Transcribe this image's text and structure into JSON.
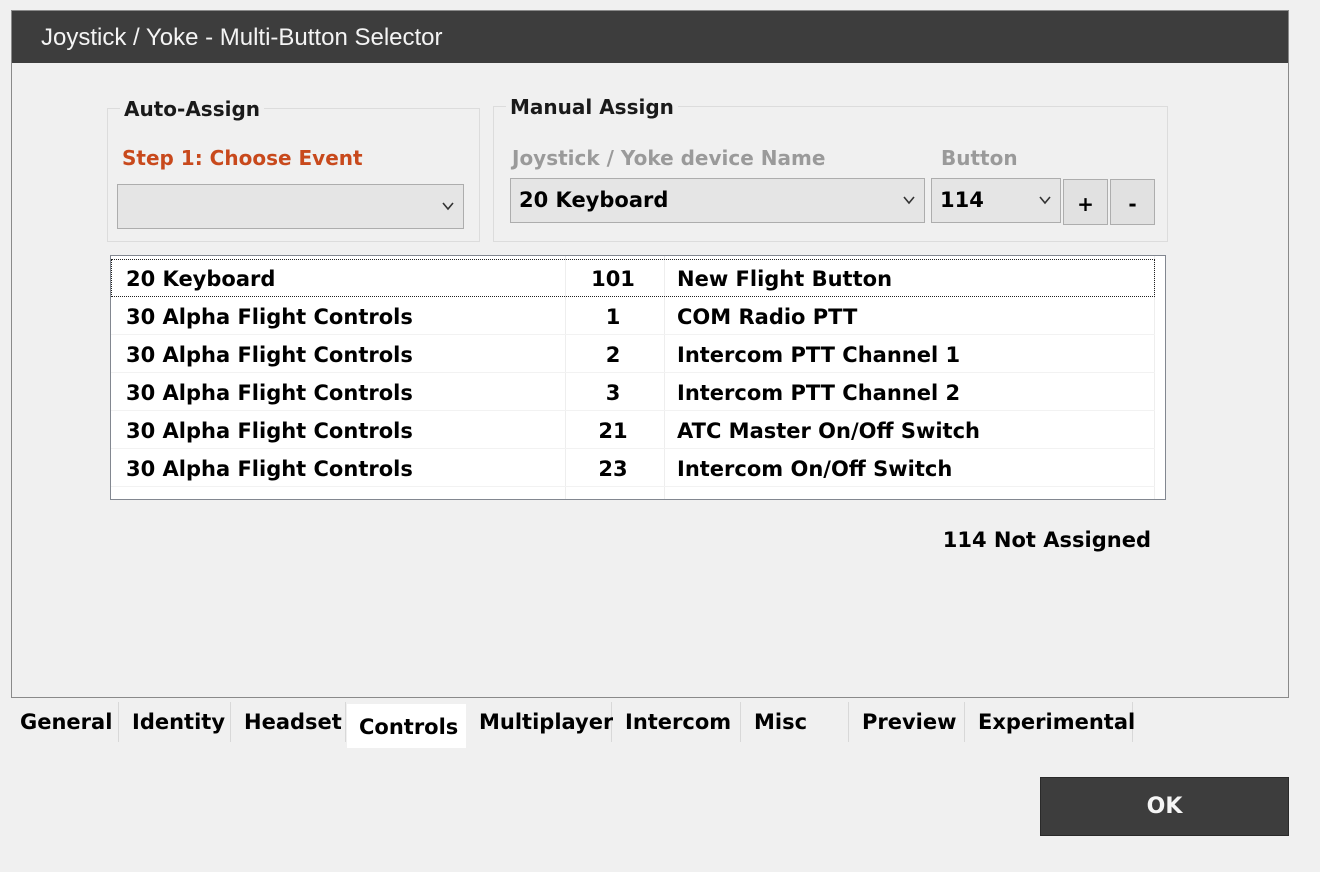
{
  "window": {
    "title": "Joystick / Yoke - Multi-Button Selector"
  },
  "auto_assign": {
    "legend": "Auto-Assign",
    "step_label": "Step 1: Choose Event",
    "event_value": ""
  },
  "manual_assign": {
    "legend": "Manual Assign",
    "device_label": "Joystick / Yoke device Name",
    "device_value": "20  Keyboard",
    "button_label": "Button",
    "button_value": "114",
    "plus_label": "+",
    "minus_label": "-"
  },
  "assignments": [
    {
      "device": "20  Keyboard",
      "button": "101",
      "action": "New Flight Button"
    },
    {
      "device": "30  Alpha Flight Controls",
      "button": "1",
      "action": "COM Radio PTT"
    },
    {
      "device": "30  Alpha Flight Controls",
      "button": "2",
      "action": "Intercom PTT Channel 1"
    },
    {
      "device": "30  Alpha Flight Controls",
      "button": "3",
      "action": "Intercom PTT Channel 2"
    },
    {
      "device": "30  Alpha Flight Controls",
      "button": "21",
      "action": "ATC Master On/Off Switch"
    },
    {
      "device": "30  Alpha Flight Controls",
      "button": "23",
      "action": "Intercom On/Off Switch"
    }
  ],
  "status_text": "114  Not Assigned",
  "tabs": [
    {
      "label": "General"
    },
    {
      "label": "Identity"
    },
    {
      "label": "Headset"
    },
    {
      "label": "Controls",
      "active": true
    },
    {
      "label": "Multiplayer"
    },
    {
      "label": "Intercom"
    },
    {
      "label": "Misc"
    },
    {
      "label": "Preview"
    },
    {
      "label": "Experimental"
    }
  ],
  "ok_label": "OK",
  "colors": {
    "titlebar": "#3d3d3d",
    "step_label": "#c8491c",
    "ok_button": "#3d3d3d"
  },
  "icons": {
    "dropdown": "chevron-down-icon"
  }
}
